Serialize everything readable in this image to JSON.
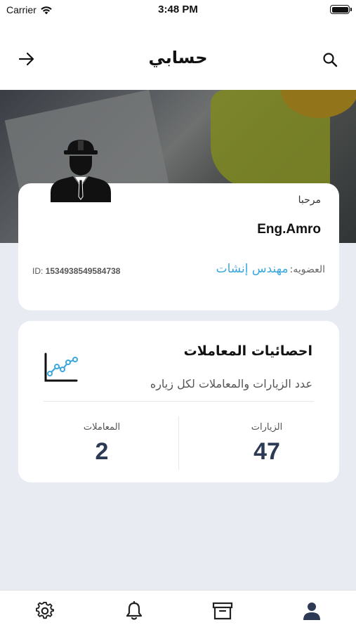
{
  "status_bar": {
    "carrier": "Carrier",
    "time": "3:48 PM"
  },
  "nav": {
    "title": "حسابي"
  },
  "profile": {
    "greeting": "مرحبا",
    "name": "Eng.Amro",
    "membership_label": "العضويه:",
    "membership_value": "مهندس إنشات",
    "id_label": "ID:",
    "id_value": "1534938549584738"
  },
  "stats": {
    "title": "احصائيات المعاملات",
    "subtitle": "عدد الزيارات والمعاملات لكل زياره",
    "visits_label": "الزيارات",
    "visits_value": "47",
    "transactions_label": "المعاملات",
    "transactions_value": "2"
  },
  "tab_bar": {
    "items": [
      {
        "icon": "gear-icon"
      },
      {
        "icon": "bell-icon"
      },
      {
        "icon": "archive-box-icon"
      },
      {
        "icon": "user-icon"
      }
    ]
  },
  "colors": {
    "accent": "#3aa7e0",
    "stat_value": "#2d3a55",
    "background": "#e8ecf2"
  }
}
